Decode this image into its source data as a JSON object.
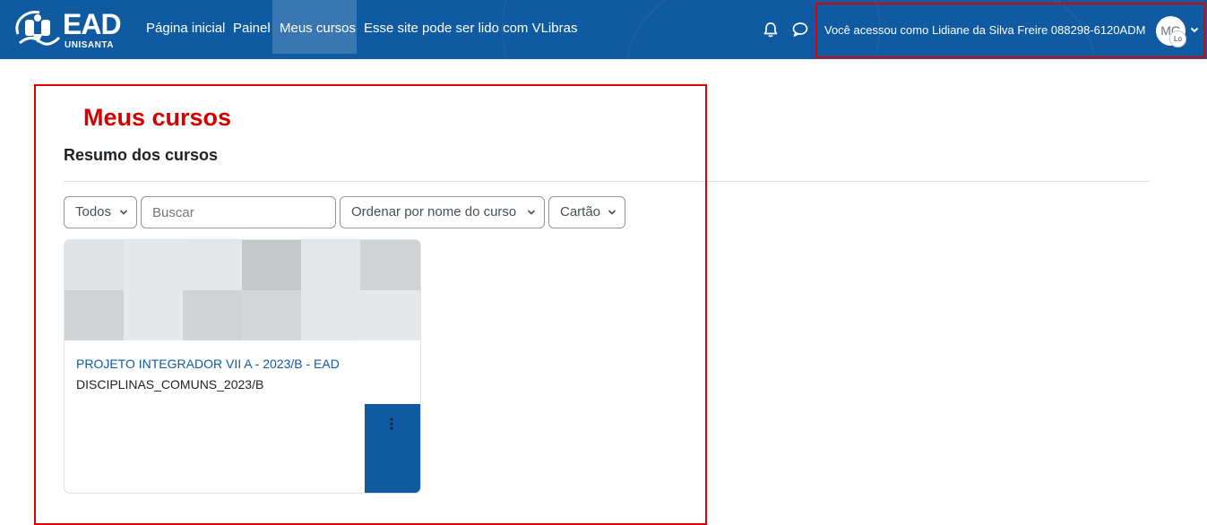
{
  "brand": {
    "logo_text": "EAD",
    "logo_subtext": "UNISANTA"
  },
  "nav": {
    "items": [
      {
        "label": "Página inicial"
      },
      {
        "label": "Painel"
      },
      {
        "label": "Meus cursos"
      },
      {
        "label": "Esse site pode ser lido com VLibras"
      }
    ],
    "active": "Meus cursos"
  },
  "user": {
    "logged_in_as": "Você acessou como Lidiane da Silva Freire 088298-6120ADM",
    "avatar_initials": "MG",
    "avatar_secondary": "Lo"
  },
  "page": {
    "title": "Meus cursos"
  },
  "overview": {
    "heading": "Resumo dos cursos",
    "filters": {
      "grouping": "Todos",
      "search_placeholder": "Buscar",
      "sort": "Ordenar por nome do curso",
      "view": "Cartão"
    }
  },
  "courses": [
    {
      "name": "PROJETO INTEGRADOR VII A - 2023/B - EAD",
      "category": "DISCIPLINAS_COMUNS_2023/B"
    }
  ],
  "colors": {
    "primary": "#0f5aa0",
    "highlight": "#e00000",
    "title_red": "#d40000"
  },
  "icons": {
    "notifications": "bell-icon",
    "messages": "chat-bubble-icon",
    "menu": "kebab-icon"
  }
}
